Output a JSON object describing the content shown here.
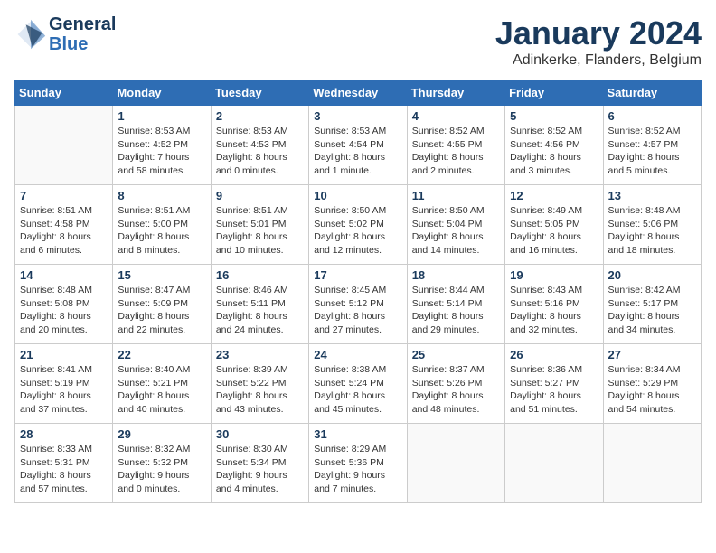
{
  "header": {
    "logo_line1": "General",
    "logo_line2": "Blue",
    "month": "January 2024",
    "location": "Adinkerke, Flanders, Belgium"
  },
  "days_of_week": [
    "Sunday",
    "Monday",
    "Tuesday",
    "Wednesday",
    "Thursday",
    "Friday",
    "Saturday"
  ],
  "weeks": [
    [
      {
        "day": "",
        "sunrise": "",
        "sunset": "",
        "daylight": ""
      },
      {
        "day": "1",
        "sunrise": "Sunrise: 8:53 AM",
        "sunset": "Sunset: 4:52 PM",
        "daylight": "Daylight: 7 hours and 58 minutes."
      },
      {
        "day": "2",
        "sunrise": "Sunrise: 8:53 AM",
        "sunset": "Sunset: 4:53 PM",
        "daylight": "Daylight: 8 hours and 0 minutes."
      },
      {
        "day": "3",
        "sunrise": "Sunrise: 8:53 AM",
        "sunset": "Sunset: 4:54 PM",
        "daylight": "Daylight: 8 hours and 1 minute."
      },
      {
        "day": "4",
        "sunrise": "Sunrise: 8:52 AM",
        "sunset": "Sunset: 4:55 PM",
        "daylight": "Daylight: 8 hours and 2 minutes."
      },
      {
        "day": "5",
        "sunrise": "Sunrise: 8:52 AM",
        "sunset": "Sunset: 4:56 PM",
        "daylight": "Daylight: 8 hours and 3 minutes."
      },
      {
        "day": "6",
        "sunrise": "Sunrise: 8:52 AM",
        "sunset": "Sunset: 4:57 PM",
        "daylight": "Daylight: 8 hours and 5 minutes."
      }
    ],
    [
      {
        "day": "7",
        "sunrise": "Sunrise: 8:51 AM",
        "sunset": "Sunset: 4:58 PM",
        "daylight": "Daylight: 8 hours and 6 minutes."
      },
      {
        "day": "8",
        "sunrise": "Sunrise: 8:51 AM",
        "sunset": "Sunset: 5:00 PM",
        "daylight": "Daylight: 8 hours and 8 minutes."
      },
      {
        "day": "9",
        "sunrise": "Sunrise: 8:51 AM",
        "sunset": "Sunset: 5:01 PM",
        "daylight": "Daylight: 8 hours and 10 minutes."
      },
      {
        "day": "10",
        "sunrise": "Sunrise: 8:50 AM",
        "sunset": "Sunset: 5:02 PM",
        "daylight": "Daylight: 8 hours and 12 minutes."
      },
      {
        "day": "11",
        "sunrise": "Sunrise: 8:50 AM",
        "sunset": "Sunset: 5:04 PM",
        "daylight": "Daylight: 8 hours and 14 minutes."
      },
      {
        "day": "12",
        "sunrise": "Sunrise: 8:49 AM",
        "sunset": "Sunset: 5:05 PM",
        "daylight": "Daylight: 8 hours and 16 minutes."
      },
      {
        "day": "13",
        "sunrise": "Sunrise: 8:48 AM",
        "sunset": "Sunset: 5:06 PM",
        "daylight": "Daylight: 8 hours and 18 minutes."
      }
    ],
    [
      {
        "day": "14",
        "sunrise": "Sunrise: 8:48 AM",
        "sunset": "Sunset: 5:08 PM",
        "daylight": "Daylight: 8 hours and 20 minutes."
      },
      {
        "day": "15",
        "sunrise": "Sunrise: 8:47 AM",
        "sunset": "Sunset: 5:09 PM",
        "daylight": "Daylight: 8 hours and 22 minutes."
      },
      {
        "day": "16",
        "sunrise": "Sunrise: 8:46 AM",
        "sunset": "Sunset: 5:11 PM",
        "daylight": "Daylight: 8 hours and 24 minutes."
      },
      {
        "day": "17",
        "sunrise": "Sunrise: 8:45 AM",
        "sunset": "Sunset: 5:12 PM",
        "daylight": "Daylight: 8 hours and 27 minutes."
      },
      {
        "day": "18",
        "sunrise": "Sunrise: 8:44 AM",
        "sunset": "Sunset: 5:14 PM",
        "daylight": "Daylight: 8 hours and 29 minutes."
      },
      {
        "day": "19",
        "sunrise": "Sunrise: 8:43 AM",
        "sunset": "Sunset: 5:16 PM",
        "daylight": "Daylight: 8 hours and 32 minutes."
      },
      {
        "day": "20",
        "sunrise": "Sunrise: 8:42 AM",
        "sunset": "Sunset: 5:17 PM",
        "daylight": "Daylight: 8 hours and 34 minutes."
      }
    ],
    [
      {
        "day": "21",
        "sunrise": "Sunrise: 8:41 AM",
        "sunset": "Sunset: 5:19 PM",
        "daylight": "Daylight: 8 hours and 37 minutes."
      },
      {
        "day": "22",
        "sunrise": "Sunrise: 8:40 AM",
        "sunset": "Sunset: 5:21 PM",
        "daylight": "Daylight: 8 hours and 40 minutes."
      },
      {
        "day": "23",
        "sunrise": "Sunrise: 8:39 AM",
        "sunset": "Sunset: 5:22 PM",
        "daylight": "Daylight: 8 hours and 43 minutes."
      },
      {
        "day": "24",
        "sunrise": "Sunrise: 8:38 AM",
        "sunset": "Sunset: 5:24 PM",
        "daylight": "Daylight: 8 hours and 45 minutes."
      },
      {
        "day": "25",
        "sunrise": "Sunrise: 8:37 AM",
        "sunset": "Sunset: 5:26 PM",
        "daylight": "Daylight: 8 hours and 48 minutes."
      },
      {
        "day": "26",
        "sunrise": "Sunrise: 8:36 AM",
        "sunset": "Sunset: 5:27 PM",
        "daylight": "Daylight: 8 hours and 51 minutes."
      },
      {
        "day": "27",
        "sunrise": "Sunrise: 8:34 AM",
        "sunset": "Sunset: 5:29 PM",
        "daylight": "Daylight: 8 hours and 54 minutes."
      }
    ],
    [
      {
        "day": "28",
        "sunrise": "Sunrise: 8:33 AM",
        "sunset": "Sunset: 5:31 PM",
        "daylight": "Daylight: 8 hours and 57 minutes."
      },
      {
        "day": "29",
        "sunrise": "Sunrise: 8:32 AM",
        "sunset": "Sunset: 5:32 PM",
        "daylight": "Daylight: 9 hours and 0 minutes."
      },
      {
        "day": "30",
        "sunrise": "Sunrise: 8:30 AM",
        "sunset": "Sunset: 5:34 PM",
        "daylight": "Daylight: 9 hours and 4 minutes."
      },
      {
        "day": "31",
        "sunrise": "Sunrise: 8:29 AM",
        "sunset": "Sunset: 5:36 PM",
        "daylight": "Daylight: 9 hours and 7 minutes."
      },
      {
        "day": "",
        "sunrise": "",
        "sunset": "",
        "daylight": ""
      },
      {
        "day": "",
        "sunrise": "",
        "sunset": "",
        "daylight": ""
      },
      {
        "day": "",
        "sunrise": "",
        "sunset": "",
        "daylight": ""
      }
    ]
  ]
}
